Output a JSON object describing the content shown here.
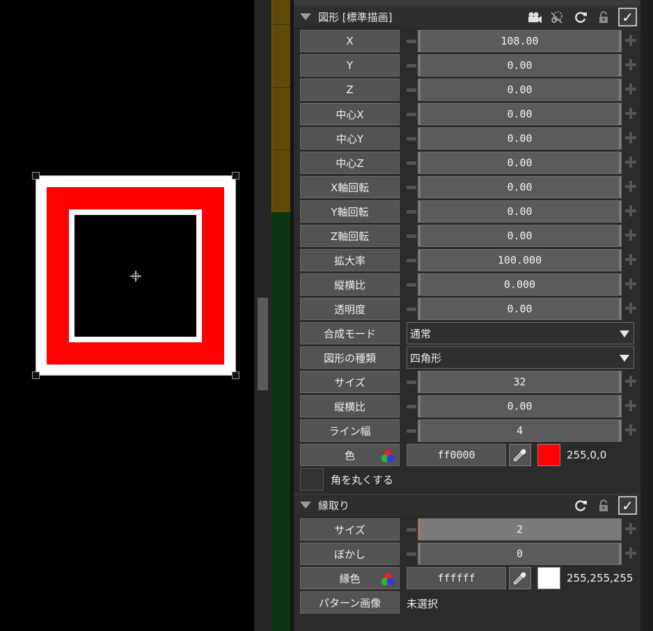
{
  "colors": {
    "primary_red": "#ff0000",
    "edge_white": "#ffffff"
  },
  "section1": {
    "title": "図形 [標準描画]",
    "icons": [
      "camera-icon",
      "dashed-lasso-icon",
      "refresh-icon",
      "lock-icon",
      "checkbox-checked-icon"
    ],
    "params": [
      {
        "label": "X",
        "value": "108.00"
      },
      {
        "label": "Y",
        "value": "0.00"
      },
      {
        "label": "Z",
        "value": "0.00"
      },
      {
        "label": "中心X",
        "value": "0.00"
      },
      {
        "label": "中心Y",
        "value": "0.00"
      },
      {
        "label": "中心Z",
        "value": "0.00"
      },
      {
        "label": "X軸回転",
        "value": "0.00"
      },
      {
        "label": "Y軸回転",
        "value": "0.00"
      },
      {
        "label": "Z軸回転",
        "value": "0.00"
      },
      {
        "label": "拡大率",
        "value": "100.000"
      },
      {
        "label": "縦横比",
        "value": "0.000"
      },
      {
        "label": "透明度",
        "value": "0.00"
      }
    ],
    "blend_mode": {
      "label": "合成モード",
      "value": "通常"
    },
    "shape_type": {
      "label": "図形の種類",
      "value": "四角形"
    },
    "params2": [
      {
        "label": "サイズ",
        "value": "32"
      },
      {
        "label": "縦横比",
        "value": "0.00"
      },
      {
        "label": "ライン幅",
        "value": "4"
      }
    ],
    "color": {
      "label": "色",
      "hex": "ff0000",
      "rgb": "255,0,0",
      "swatch": "#ff0000"
    },
    "round_corners": {
      "label": "角を丸くする",
      "checked": false
    }
  },
  "section2": {
    "title": "縁取り",
    "icons": [
      "refresh-icon",
      "lock-icon",
      "checkbox-checked-icon"
    ],
    "params": [
      {
        "label": "サイズ",
        "value": "2"
      },
      {
        "label": "ぼかし",
        "value": "0"
      }
    ],
    "edge_color": {
      "label": "縁色",
      "hex": "ffffff",
      "rgb": "255,255,255",
      "swatch": "#ffffff"
    },
    "pattern": {
      "label": "パターン画像",
      "value": "未選択"
    }
  }
}
